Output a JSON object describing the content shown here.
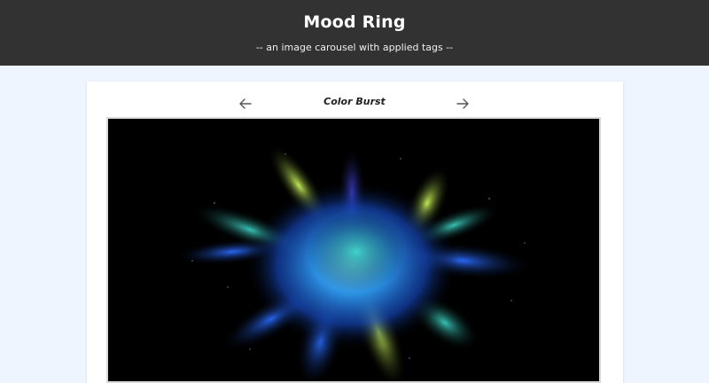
{
  "header": {
    "title": "Mood Ring",
    "subtitle": "-- an image carousel with applied tags --"
  },
  "carousel": {
    "current_title": "Color Burst",
    "prev_icon": "arrow-left-icon",
    "next_icon": "arrow-right-icon"
  },
  "colors": {
    "header_bg": "#323232",
    "page_bg": "#eef5ff",
    "card_bg": "#ffffff"
  }
}
